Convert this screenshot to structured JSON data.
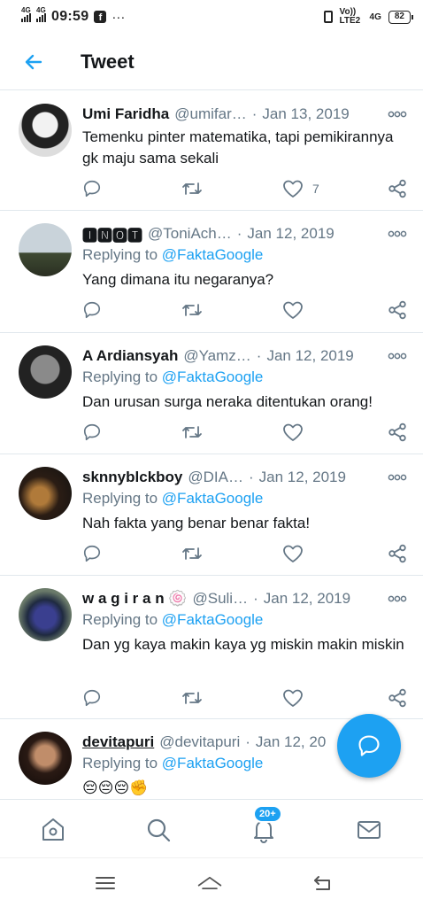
{
  "status_bar": {
    "time": "09:59",
    "network_left": [
      "4G",
      "4G"
    ],
    "overflow": "···",
    "volte": "Vo)) LTE2",
    "network_right": "4G",
    "battery": "82"
  },
  "header": {
    "title": "Tweet",
    "back_icon": "arrow-left-icon"
  },
  "colors": {
    "accent": "#1da1f2",
    "secondary_text": "#657786",
    "divider": "#e1e8ed"
  },
  "tweets": [
    {
      "name": "Umi Faridha",
      "handle": "@umifar…",
      "date": "Jan 13, 2019",
      "reply_label": "",
      "reply_handle": "",
      "text": "Temenku pinter matematika, tapi pemikirannya gk maju sama sekali",
      "likes": "7"
    },
    {
      "name": "🅸🅽🅾🆃",
      "handle": "@ToniAch…",
      "date": "Jan 12, 2019",
      "reply_label": "Replying to",
      "reply_handle": "@FaktaGoogle",
      "text": "Yang dimana itu negaranya?",
      "likes": ""
    },
    {
      "name": "A Ardiansyah",
      "handle": "@Yamz…",
      "date": "Jan 12, 2019",
      "reply_label": "Replying to",
      "reply_handle": "@FaktaGoogle",
      "text": "Dan urusan surga neraka ditentukan orang!",
      "likes": ""
    },
    {
      "name": "sknnyblckboy",
      "handle": "@DIA…",
      "date": "Jan 12, 2019",
      "reply_label": "Replying to",
      "reply_handle": "@FaktaGoogle",
      "text": "Nah fakta yang benar benar fakta!",
      "likes": ""
    },
    {
      "name": "w a g i r a n 🍥",
      "handle": "@Suli…",
      "date": "Jan 12, 2019",
      "reply_label": "Replying to",
      "reply_handle": "@FaktaGoogle",
      "text": "Dan yg kaya makin kaya yg miskin makin miskin",
      "likes": ""
    },
    {
      "name": "devitapuri",
      "handle": "@devitapuri",
      "date": "Jan 12, 20",
      "reply_label": "Replying to",
      "reply_handle": "@FaktaGoogle",
      "text": "😔😔😔✊",
      "likes": ""
    }
  ],
  "bottom_nav": {
    "items": [
      "home-icon",
      "search-icon",
      "notifications-icon",
      "messages-icon"
    ],
    "notification_badge": "20+"
  },
  "fab": {
    "icon": "compose-reply-icon"
  },
  "system_nav": [
    "menu-icon",
    "home-icon",
    "back-icon"
  ]
}
